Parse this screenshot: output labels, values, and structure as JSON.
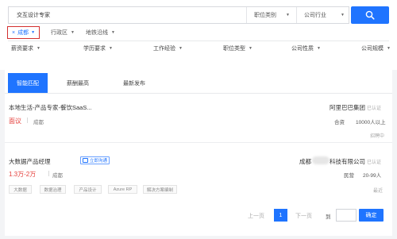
{
  "search": {
    "query": "交互设计专家",
    "job_category": "职位类别",
    "industry": "公司行业"
  },
  "filters": {
    "city_tag": "成都",
    "district": "行政区",
    "subway": "地铁沿线"
  },
  "criteria": [
    "薪资要求",
    "学历要求",
    "工作经验",
    "职位类型",
    "公司性质",
    "公司规模"
  ],
  "tabs": [
    "智能匹配",
    "薪酬最高",
    "最新发布"
  ],
  "jobs": [
    {
      "title": "本地生活-产品专家-餐饮SaaS...",
      "salary": "面议",
      "location": "成都",
      "company": "阿里巴巴集团",
      "company_badge": "已认证",
      "company_type": "合资",
      "company_size": "10000人以上",
      "status": "招聘中"
    },
    {
      "title": "大数据产品经理",
      "chat_label": "立即沟通",
      "salary": "1.3万-2万",
      "location": "成都",
      "company_prefix": "成都",
      "company_suffix": "科技有限公司",
      "company_badge": "已认证",
      "company_type": "民营",
      "company_size": "20-99人",
      "status": "最近",
      "skills": [
        "大数据",
        "数据治理",
        "产品设计",
        "Azure RP",
        "解决方案编制"
      ]
    }
  ],
  "pagination": {
    "prev": "上一页",
    "current": "1",
    "next": "下一页",
    "goto": "到",
    "confirm": "确定"
  }
}
